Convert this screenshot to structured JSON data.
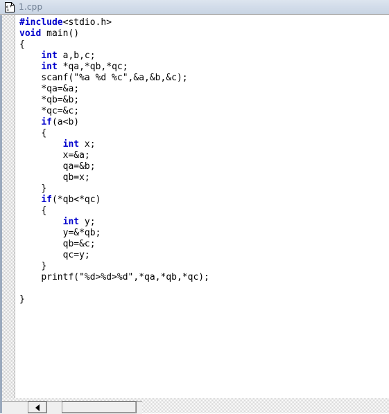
{
  "window": {
    "title": "1.cpp",
    "icon": "cpp-file-icon"
  },
  "editor": {
    "language": "C",
    "keyword_color": "#0000cc",
    "text_color": "#000000",
    "background_color": "#ffffff",
    "gutter_color": "#cfcfcf",
    "lines": [
      {
        "indent": 0,
        "tokens": [
          {
            "t": "kw",
            "v": "#include"
          },
          {
            "t": "pl",
            "v": "<stdio.h>"
          }
        ]
      },
      {
        "indent": 0,
        "tokens": [
          {
            "t": "kw",
            "v": "void"
          },
          {
            "t": "pl",
            "v": " main()"
          }
        ]
      },
      {
        "indent": 0,
        "tokens": [
          {
            "t": "pl",
            "v": "{"
          }
        ]
      },
      {
        "indent": 1,
        "tokens": [
          {
            "t": "kw",
            "v": "int"
          },
          {
            "t": "pl",
            "v": " a,b,c;"
          }
        ]
      },
      {
        "indent": 1,
        "tokens": [
          {
            "t": "kw",
            "v": "int"
          },
          {
            "t": "pl",
            "v": " *qa,*qb,*qc;"
          }
        ]
      },
      {
        "indent": 1,
        "tokens": [
          {
            "t": "pl",
            "v": "scanf(\"%a %d %c\",&a,&b,&c);"
          }
        ]
      },
      {
        "indent": 1,
        "tokens": [
          {
            "t": "pl",
            "v": "*qa=&a;"
          }
        ]
      },
      {
        "indent": 1,
        "tokens": [
          {
            "t": "pl",
            "v": "*qb=&b;"
          }
        ]
      },
      {
        "indent": 1,
        "tokens": [
          {
            "t": "pl",
            "v": "*qc=&c;"
          }
        ]
      },
      {
        "indent": 1,
        "tokens": [
          {
            "t": "kw",
            "v": "if"
          },
          {
            "t": "pl",
            "v": "(a<b)"
          }
        ]
      },
      {
        "indent": 1,
        "tokens": [
          {
            "t": "pl",
            "v": "{"
          }
        ]
      },
      {
        "indent": 2,
        "tokens": [
          {
            "t": "kw",
            "v": "int"
          },
          {
            "t": "pl",
            "v": " x;"
          }
        ]
      },
      {
        "indent": 2,
        "tokens": [
          {
            "t": "pl",
            "v": "x=&a;"
          }
        ]
      },
      {
        "indent": 2,
        "tokens": [
          {
            "t": "pl",
            "v": "qa=&b;"
          }
        ]
      },
      {
        "indent": 2,
        "tokens": [
          {
            "t": "pl",
            "v": "qb=x;"
          }
        ]
      },
      {
        "indent": 1,
        "tokens": [
          {
            "t": "pl",
            "v": "}"
          }
        ]
      },
      {
        "indent": 1,
        "tokens": [
          {
            "t": "kw",
            "v": "if"
          },
          {
            "t": "pl",
            "v": "(*qb<*qc)"
          }
        ]
      },
      {
        "indent": 1,
        "tokens": [
          {
            "t": "pl",
            "v": "{"
          }
        ]
      },
      {
        "indent": 2,
        "tokens": [
          {
            "t": "kw",
            "v": "int"
          },
          {
            "t": "pl",
            "v": " y;"
          }
        ]
      },
      {
        "indent": 2,
        "tokens": [
          {
            "t": "pl",
            "v": "y=&*qb;"
          }
        ]
      },
      {
        "indent": 2,
        "tokens": [
          {
            "t": "pl",
            "v": "qb=&c;"
          }
        ]
      },
      {
        "indent": 2,
        "tokens": [
          {
            "t": "pl",
            "v": "qc=y;"
          }
        ]
      },
      {
        "indent": 1,
        "tokens": [
          {
            "t": "pl",
            "v": "}"
          }
        ]
      },
      {
        "indent": 1,
        "tokens": [
          {
            "t": "pl",
            "v": "printf(\"%d>%d>%d\",*qa,*qb,*qc);"
          }
        ]
      },
      {
        "indent": 0,
        "tokens": []
      },
      {
        "indent": 0,
        "tokens": [
          {
            "t": "pl",
            "v": "}"
          }
        ]
      }
    ]
  },
  "horizontal_scrollbar": {
    "left_button_icon": "triangle-left-icon",
    "thumb_label": "",
    "track_color": "#efefef"
  }
}
